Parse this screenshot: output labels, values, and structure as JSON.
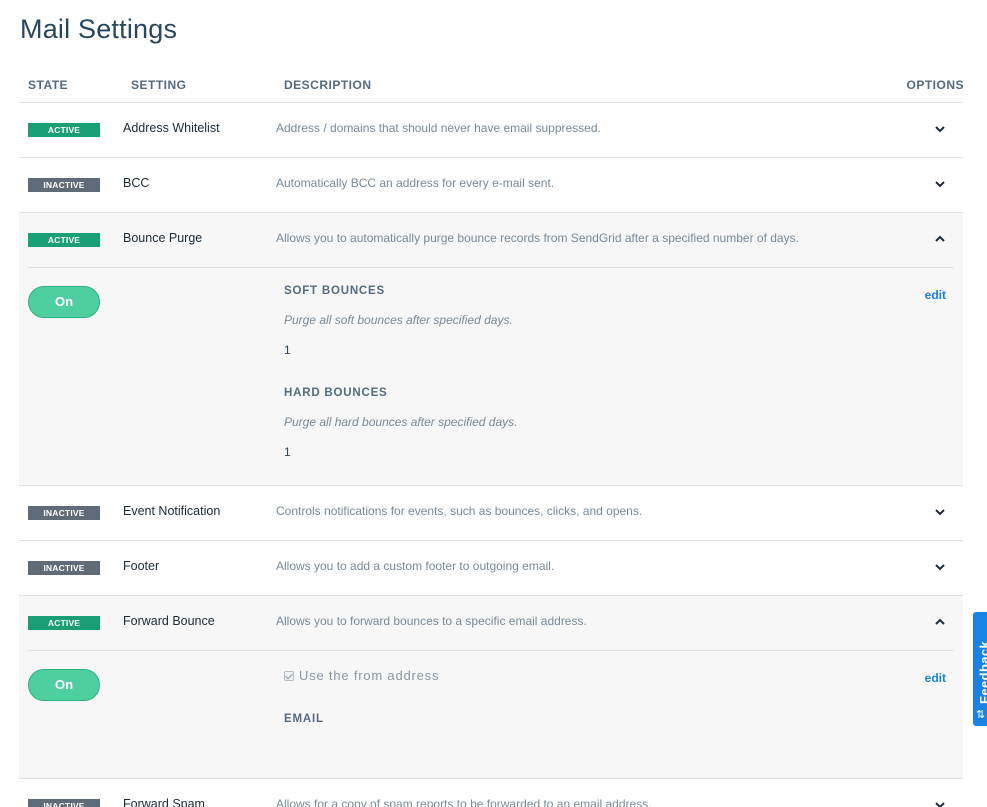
{
  "page": {
    "title": "Mail Settings"
  },
  "table": {
    "headers": {
      "state": "STATE",
      "setting": "SETTING",
      "description": "DESCRIPTION",
      "options": "OPTIONS"
    },
    "rows": [
      {
        "state": "ACTIVE",
        "name": "Address Whitelist",
        "description": "Address / domains that should never have email suppressed."
      },
      {
        "state": "INACTIVE",
        "name": "BCC",
        "description": "Automatically BCC an address for every e-mail sent."
      },
      {
        "state": "ACTIVE",
        "name": "Bounce Purge",
        "description": "Allows you to automatically purge bounce records from SendGrid after a specified number of days."
      },
      {
        "state": "INACTIVE",
        "name": "Event Notification",
        "description": "Controls notifications for events, such as bounces, clicks, and opens."
      },
      {
        "state": "INACTIVE",
        "name": "Footer",
        "description": "Allows you to add a custom footer to outgoing email."
      },
      {
        "state": "ACTIVE",
        "name": "Forward Bounce",
        "description": "Allows you to forward bounces to a specific email address."
      },
      {
        "state": "INACTIVE",
        "name": "Forward Spam",
        "description": "Allows for a copy of spam reports to be forwarded to an email address."
      }
    ]
  },
  "bounce_purge_detail": {
    "toggle": "On",
    "edit": "edit",
    "soft_heading": "SOFT BOUNCES",
    "soft_desc": "Purge all soft bounces after specified days.",
    "soft_value": "1",
    "hard_heading": "HARD BOUNCES",
    "hard_desc": "Purge all hard bounces after specified days.",
    "hard_value": "1"
  },
  "forward_bounce_detail": {
    "toggle": "On",
    "edit": "edit",
    "checkbox_label": "Use the from address",
    "checkbox_checked": true,
    "email_heading": "EMAIL"
  },
  "feedback": {
    "label": "Feedback",
    "icon": "sliders-icon"
  },
  "colors": {
    "active": "#1a9e73",
    "inactive": "#5f6b78",
    "toggle": "#4ecf9f",
    "link": "#1a82e2",
    "feedback": "#1a82e2"
  }
}
